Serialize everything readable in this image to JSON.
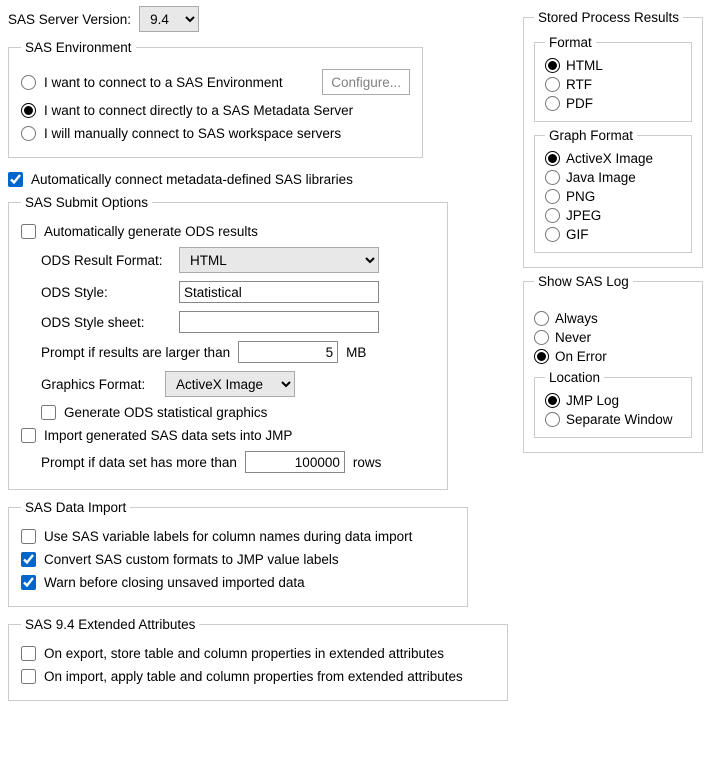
{
  "header": {
    "version_label": "SAS Server Version:",
    "version_selected": "9.4"
  },
  "env": {
    "legend": "SAS Environment",
    "opt_connect_env": "I want to connect to a SAS Environment",
    "configure_btn": "Configure...",
    "opt_connect_metadata": "I want to connect directly to a SAS Metadata Server",
    "opt_manual": "I will manually connect to SAS workspace servers"
  },
  "auto_connect_libs": "Automatically connect metadata-defined SAS libraries",
  "submit": {
    "legend": "SAS Submit Options",
    "auto_ods": "Automatically generate ODS results",
    "ods_result_format_label": "ODS Result Format:",
    "ods_result_format_value": "HTML",
    "ods_style_label": "ODS Style:",
    "ods_style_value": "Statistical",
    "ods_stylesheet_label": "ODS Style sheet:",
    "ods_stylesheet_value": "",
    "prompt_results_prefix": "Prompt if results are larger than",
    "prompt_results_value": "5",
    "prompt_results_suffix": "MB",
    "graphics_format_label": "Graphics Format:",
    "graphics_format_value": "ActiveX Image",
    "gen_ods_stats": "Generate ODS statistical graphics",
    "import_generated": "Import generated SAS data sets into JMP",
    "prompt_rows_prefix": "Prompt if data set has more than",
    "prompt_rows_value": "100000",
    "prompt_rows_suffix": "rows"
  },
  "data_import": {
    "legend": "SAS Data Import",
    "use_var_labels": "Use SAS variable labels for column names during data import",
    "convert_formats": "Convert SAS custom formats to JMP value labels",
    "warn_unsaved": "Warn before closing unsaved imported data"
  },
  "ext_attrs": {
    "legend": "SAS 9.4 Extended Attributes",
    "on_export": "On export, store table and column properties in extended attributes",
    "on_import": "On import, apply table and column properties from extended attributes"
  },
  "stored": {
    "legend": "Stored Process Results",
    "format": {
      "legend": "Format",
      "html": "HTML",
      "rtf": "RTF",
      "pdf": "PDF"
    },
    "graph_format": {
      "legend": "Graph Format",
      "activex": "ActiveX Image",
      "java": "Java Image",
      "png": "PNG",
      "jpeg": "JPEG",
      "gif": "GIF"
    }
  },
  "saslog": {
    "legend": "Show SAS Log",
    "always": "Always",
    "never": "Never",
    "on_error": "On Error",
    "location": {
      "legend": "Location",
      "jmp_log": "JMP Log",
      "sep_window": "Separate Window"
    }
  }
}
